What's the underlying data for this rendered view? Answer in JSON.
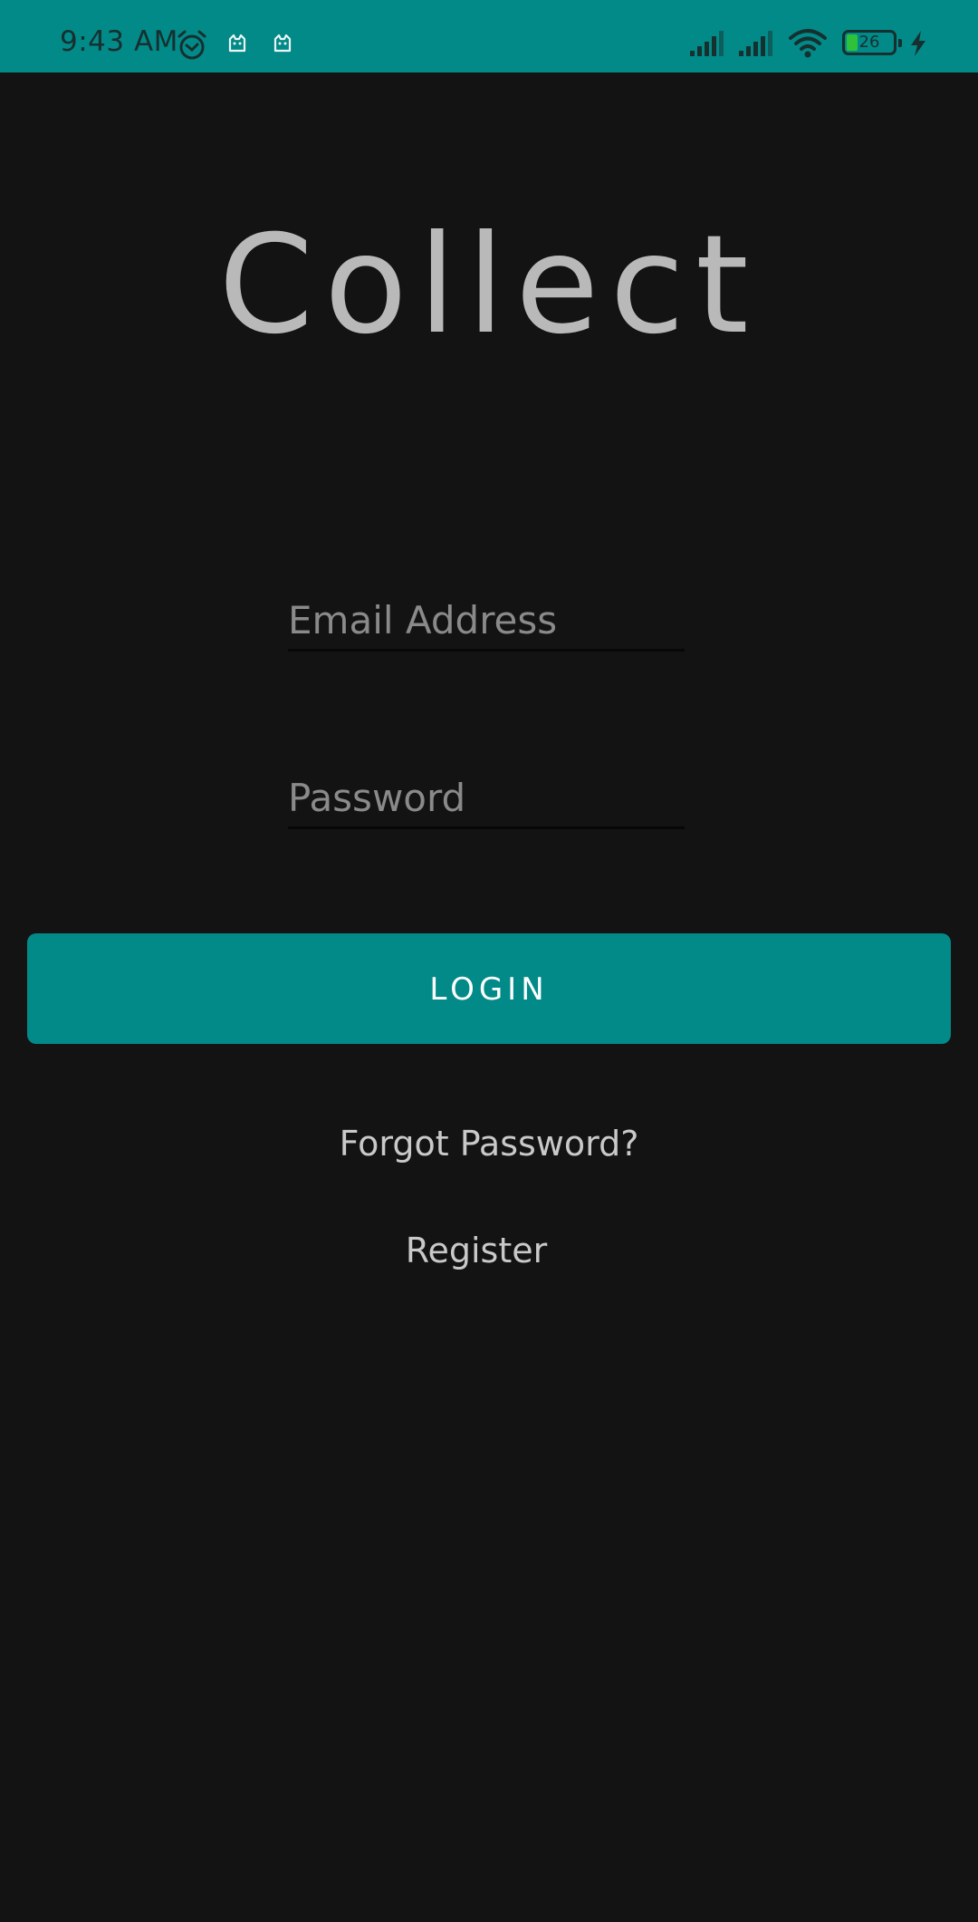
{
  "status_bar": {
    "time": "9:43 AM",
    "battery_level": "26",
    "icons": [
      "alarm-icon",
      "cat-icon",
      "cat-icon",
      "signal-icon",
      "signal-icon",
      "wifi-icon",
      "battery-icon",
      "charging-icon"
    ],
    "background_color": "#028a89"
  },
  "app": {
    "title": "Collect"
  },
  "form": {
    "email_placeholder": "Email Address",
    "email_value": "",
    "password_placeholder": "Password",
    "password_value": "",
    "login_label": "LOGIN",
    "forgot_label": "Forgot Password?",
    "register_label": "Register"
  },
  "colors": {
    "accent": "#028a89",
    "background": "#131313",
    "title_text": "#b9b9b9",
    "link_text": "#c9c9c9"
  }
}
